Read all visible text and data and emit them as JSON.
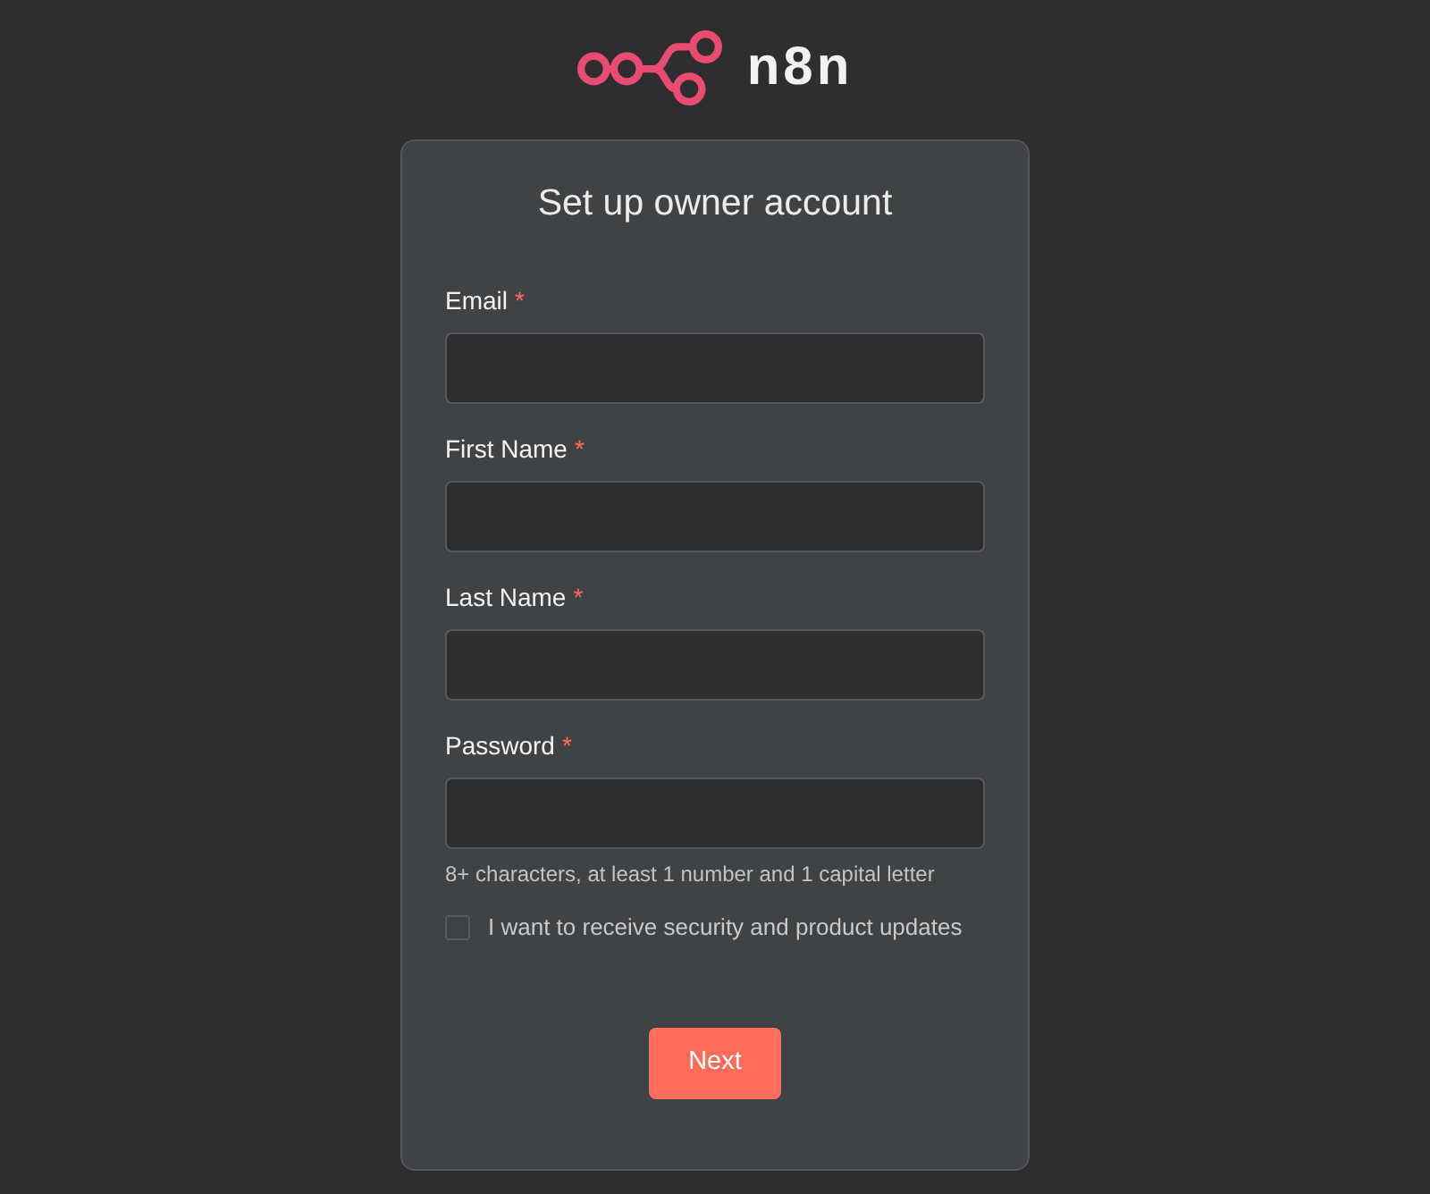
{
  "header": {
    "logo_text": "n8n"
  },
  "form": {
    "title": "Set up owner account",
    "fields": [
      {
        "label": "Email",
        "required_mark": "*"
      },
      {
        "label": "First Name",
        "required_mark": "*"
      },
      {
        "label": "Last Name",
        "required_mark": "*"
      },
      {
        "label": "Password",
        "required_mark": "*",
        "hint": "8+ characters, at least 1 number and 1 capital letter"
      }
    ],
    "consent": {
      "label": "I want to receive security and product updates",
      "checked": false
    },
    "submit_button": "Next"
  }
}
